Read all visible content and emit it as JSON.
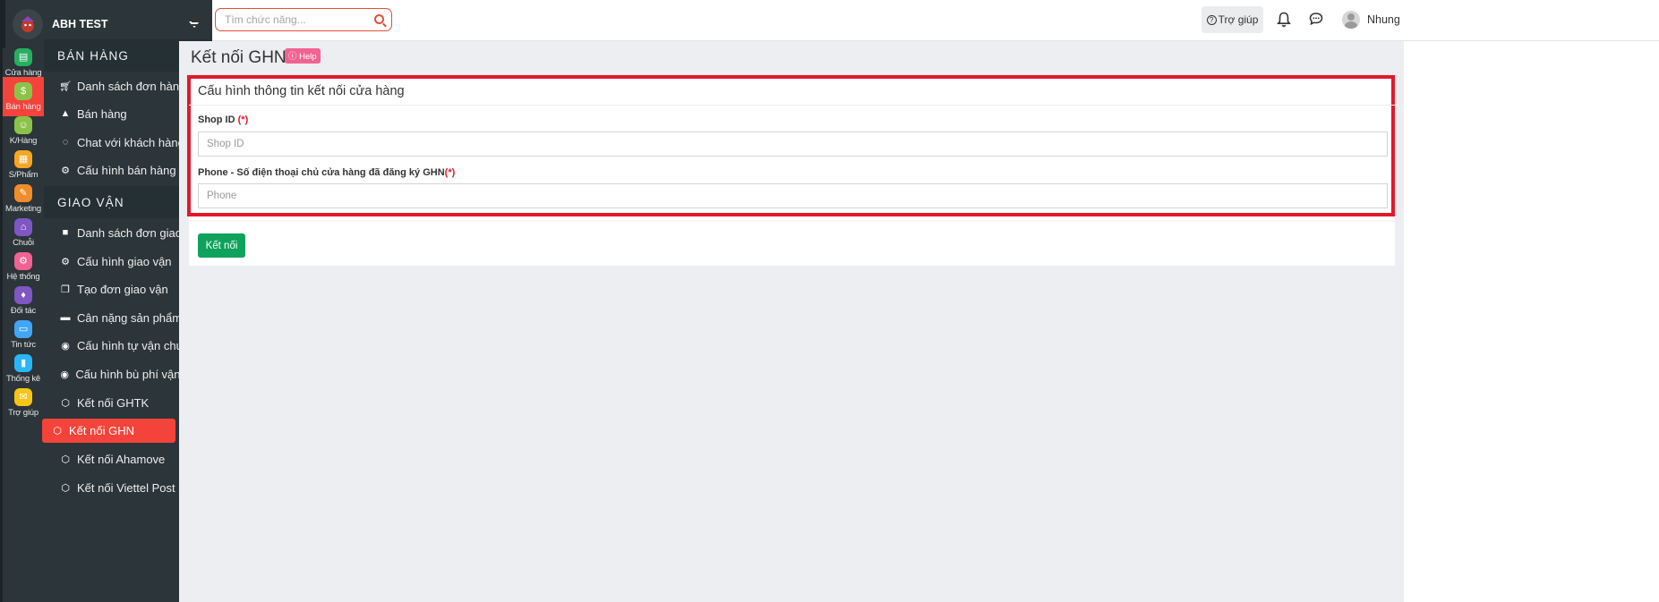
{
  "header": {
    "store_name": "ABH TEST",
    "search_placeholder": "Tìm chức năng...",
    "help_label": "Trợ giúp",
    "user_name": "Nhung"
  },
  "rail": [
    {
      "label": "Cửa hàng",
      "icon": "store-icon",
      "color": "#27ae60"
    },
    {
      "label": "Bán hàng",
      "icon": "sales-icon",
      "color": "#8bc34a"
    },
    {
      "label": "K/Hàng",
      "icon": "customer-icon",
      "color": "#8bc34a"
    },
    {
      "label": "S/Phẩm",
      "icon": "product-icon",
      "color": "#f5a623"
    },
    {
      "label": "Marketing",
      "icon": "marketing-icon",
      "color": "#f08c2a"
    },
    {
      "label": "Chuỗi",
      "icon": "chain-icon",
      "color": "#7e57c2"
    },
    {
      "label": "Hệ thống",
      "icon": "system-icon",
      "color": "#f06292"
    },
    {
      "label": "Đối tác",
      "icon": "partner-icon",
      "color": "#7e57c2"
    },
    {
      "label": "Tin tức",
      "icon": "news-icon",
      "color": "#42a5f5"
    },
    {
      "label": "Thống kê",
      "icon": "stats-icon",
      "color": "#29b6f6"
    },
    {
      "label": "Trợ giúp",
      "icon": "help-icon",
      "color": "#f5c518"
    }
  ],
  "sidebar": {
    "sections": [
      {
        "title": "BÁN HÀNG",
        "items": [
          {
            "label": "Danh sách đơn hàng",
            "icon": "cart-icon"
          },
          {
            "label": "Bán hàng",
            "icon": "bag-icon"
          },
          {
            "label": "Chat với khách hàng",
            "icon": "chat-icon"
          },
          {
            "label": "Cấu hình bán hàng",
            "icon": "gear-icon"
          }
        ]
      },
      {
        "title": "GIAO VẬN",
        "items": [
          {
            "label": "Danh sách đơn giao vận",
            "icon": "truck-icon"
          },
          {
            "label": "Cấu hình giao vận",
            "icon": "gear-icon"
          },
          {
            "label": "Tạo đơn giao vận",
            "icon": "copy-icon"
          },
          {
            "label": "Cân nặng sản phẩm",
            "icon": "box-icon"
          },
          {
            "label": "Cấu hình tự vận chuyển",
            "icon": "target-icon"
          },
          {
            "label": "Cấu hình bù phí vận chuyển",
            "icon": "target-icon"
          },
          {
            "label": "Kết nối GHTK",
            "icon": "link-icon"
          },
          {
            "label": "Kết nối GHN",
            "icon": "link-icon",
            "active": true
          },
          {
            "label": "Kết nối Ahamove",
            "icon": "link-icon"
          },
          {
            "label": "Kết nối Viettel Post",
            "icon": "link-icon"
          }
        ]
      }
    ]
  },
  "page": {
    "title": "Kết nối GHN",
    "help_badge": "Help",
    "card_title": "Cấu hình thông tin kết nối cửa hàng",
    "shop_id_label": "Shop ID",
    "required_mark": "(*)",
    "shop_id_placeholder": "Shop ID",
    "phone_label": "Phone - Số điện thoại chủ cửa hàng đã đăng ký GHN",
    "phone_placeholder": "Phone",
    "connect_button": "Kết nối"
  },
  "colors": {
    "accent": "#f4433a",
    "highlight_border": "#e0192a",
    "button_green": "#0ea25a",
    "sidebar_bg": "#2c3539"
  }
}
